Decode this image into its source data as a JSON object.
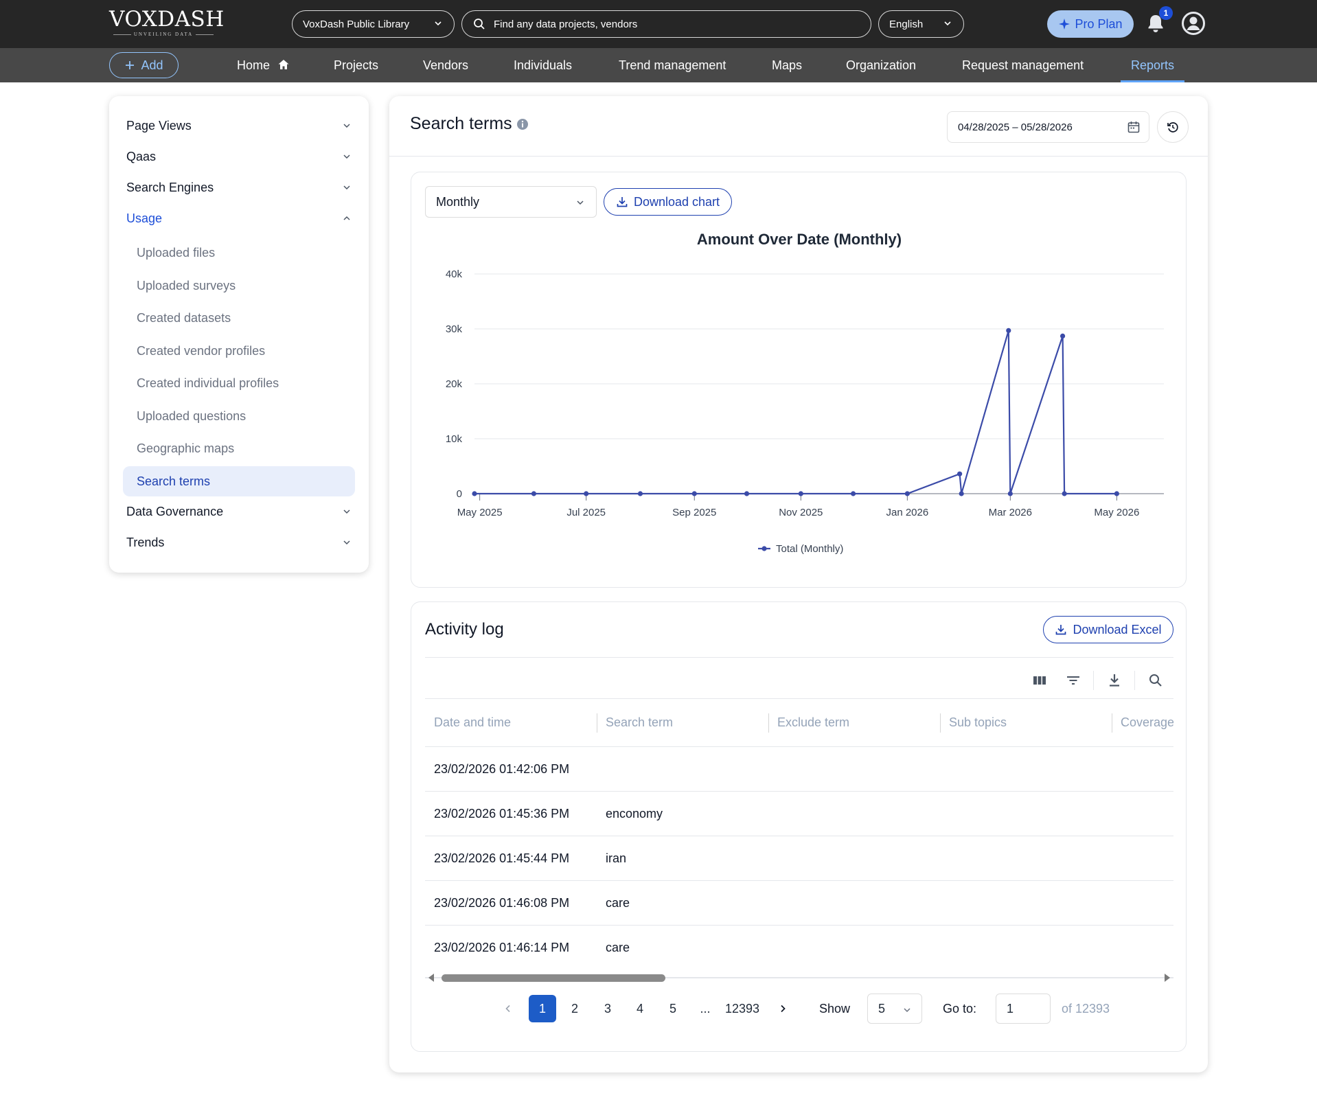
{
  "brand": {
    "name": "VoxDash",
    "tagline": "UNVEILING DATA"
  },
  "header": {
    "library": "VoxDash Public Library",
    "search_placeholder": "Find any data projects, vendors",
    "language": "English",
    "pro_plan": "Pro Plan",
    "notification_count": "1"
  },
  "nav": {
    "add_label": "Add",
    "items": [
      "Home",
      "Projects",
      "Vendors",
      "Individuals",
      "Trend management",
      "Maps",
      "Organization",
      "Request management",
      "Reports"
    ],
    "active": "Reports"
  },
  "sidebar": {
    "sections": [
      "Page Views",
      "Qaas",
      "Search Engines",
      "Usage",
      "Data Governance",
      "Trends"
    ],
    "open_section": "Usage",
    "usage_items": [
      "Uploaded files",
      "Uploaded surveys",
      "Created datasets",
      "Created vendor profiles",
      "Created individual profiles",
      "Uploaded questions",
      "Geographic maps",
      "Search terms"
    ],
    "active_item": "Search terms"
  },
  "page": {
    "title": "Search terms",
    "date_range": "04/28/2025 – 05/28/2026"
  },
  "controls": {
    "period": "Monthly",
    "download_chart": "Download chart"
  },
  "chart_data": {
    "type": "line",
    "title": "Amount Over Date (Monthly)",
    "xlabel": "",
    "ylabel": "",
    "x_tick_labels": [
      "May 2025",
      "Jul 2025",
      "Sep 2025",
      "Nov 2025",
      "Jan 2026",
      "Mar 2026",
      "May 2026"
    ],
    "y_tick_labels": [
      "0",
      "10k",
      "20k",
      "30k",
      "40k"
    ],
    "ylim": [
      0,
      40000
    ],
    "xlim": [
      "2025-04-28",
      "2026-05-28"
    ],
    "grid": true,
    "legend_position": "bottom",
    "series": [
      {
        "name": "Total (Monthly)",
        "color": "#3b4ba8",
        "points": [
          [
            "2025-04-28",
            0
          ],
          [
            "2025-06-01",
            0
          ],
          [
            "2025-07-01",
            0
          ],
          [
            "2025-08-01",
            0
          ],
          [
            "2025-09-01",
            0
          ],
          [
            "2025-10-01",
            0
          ],
          [
            "2025-11-01",
            0
          ],
          [
            "2025-12-01",
            0
          ],
          [
            "2026-01-01",
            0
          ],
          [
            "2026-01-31",
            3600
          ],
          [
            "2026-02-01",
            0
          ],
          [
            "2026-02-28",
            29700
          ],
          [
            "2026-03-01",
            0
          ],
          [
            "2026-03-31",
            28700
          ],
          [
            "2026-04-01",
            0
          ],
          [
            "2026-05-01",
            0
          ]
        ]
      }
    ]
  },
  "activity_log": {
    "title": "Activity log",
    "download_excel": "Download Excel",
    "columns": [
      "Date and time",
      "Search term",
      "Exclude term",
      "Sub topics",
      "Coverage"
    ],
    "rows": [
      [
        "23/02/2026 01:42:06 PM",
        ""
      ],
      [
        "23/02/2026 01:45:36 PM",
        "enconomy"
      ],
      [
        "23/02/2026 01:45:44 PM",
        "iran"
      ],
      [
        "23/02/2026 01:46:08 PM",
        "care"
      ],
      [
        "23/02/2026 01:46:14 PM",
        "care"
      ]
    ]
  },
  "pagination": {
    "pages": [
      "1",
      "2",
      "3",
      "4",
      "5",
      "...",
      "12393"
    ],
    "current": "1",
    "show_label": "Show",
    "page_size": "5",
    "goto_label": "Go to:",
    "goto_value": "1",
    "total_label": "of 12393"
  },
  "colors": {
    "accent": "#1d4ed8",
    "topbar": "#262626",
    "navbar": "#484848",
    "line": "#3b4ba8"
  }
}
